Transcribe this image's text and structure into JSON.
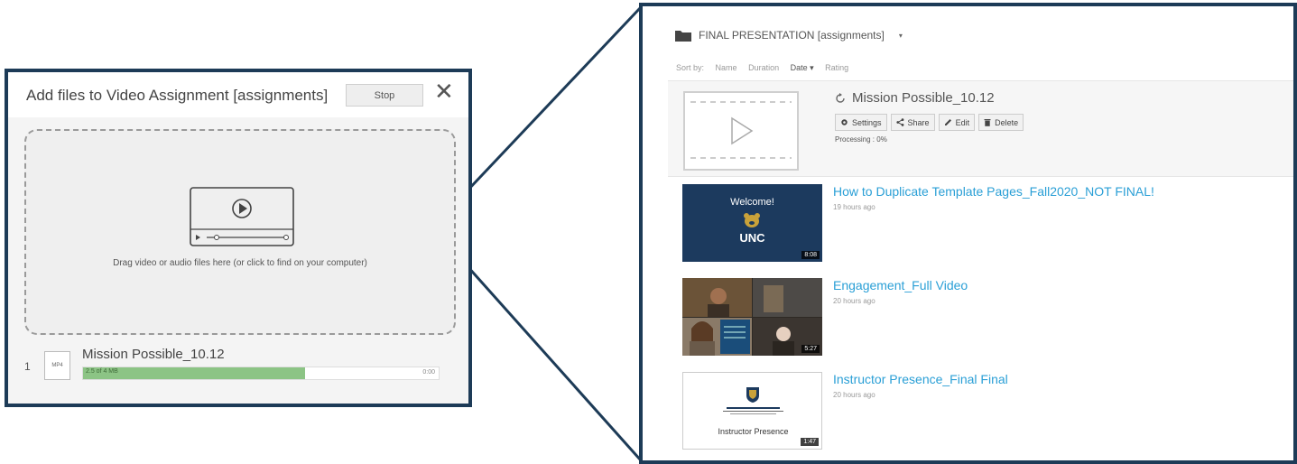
{
  "upload_dialog": {
    "title": "Add files to Video Assignment [assignments]",
    "stop_label": "Stop",
    "close_symbol": "✕",
    "drop_text": "Drag video or audio files here (or click to find on your computer)",
    "file": {
      "index": "1",
      "type": "MP4",
      "name": "Mission Possible_10.12",
      "progress_text": "2.5 of 4 MB",
      "progress_fraction": 0.625,
      "time": "0:00"
    },
    "colors": {
      "border": "#1d3b57",
      "progress": "#8cc485"
    }
  },
  "library": {
    "folder_title": "FINAL PRESENTATION [assignments]",
    "caret": "▾",
    "sort": {
      "label": "Sort by:",
      "options": [
        "Name",
        "Duration",
        "Date ▾",
        "Rating"
      ],
      "active": "Date ▾"
    },
    "processing_item": {
      "title": "Mission Possible_10.12",
      "buttons": [
        "Settings",
        "Share",
        "Edit",
        "Delete"
      ],
      "status": "Processing : 0%"
    },
    "items": [
      {
        "title": "How to Duplicate Template Pages_Fall2020_NOT FINAL!",
        "time": "19 hours ago",
        "duration": "8:08",
        "thumb_text": "Welcome!",
        "thumb_logo": "UNC"
      },
      {
        "title": "Engagement_Full Video",
        "time": "20 hours ago",
        "duration": "5:27"
      },
      {
        "title": "Instructor Presence_Final Final",
        "time": "20 hours ago",
        "duration": "1:47",
        "thumb_text": "Instructor Presence"
      }
    ],
    "colors": {
      "link": "#2a9fd6",
      "border": "#1d3b57"
    }
  }
}
